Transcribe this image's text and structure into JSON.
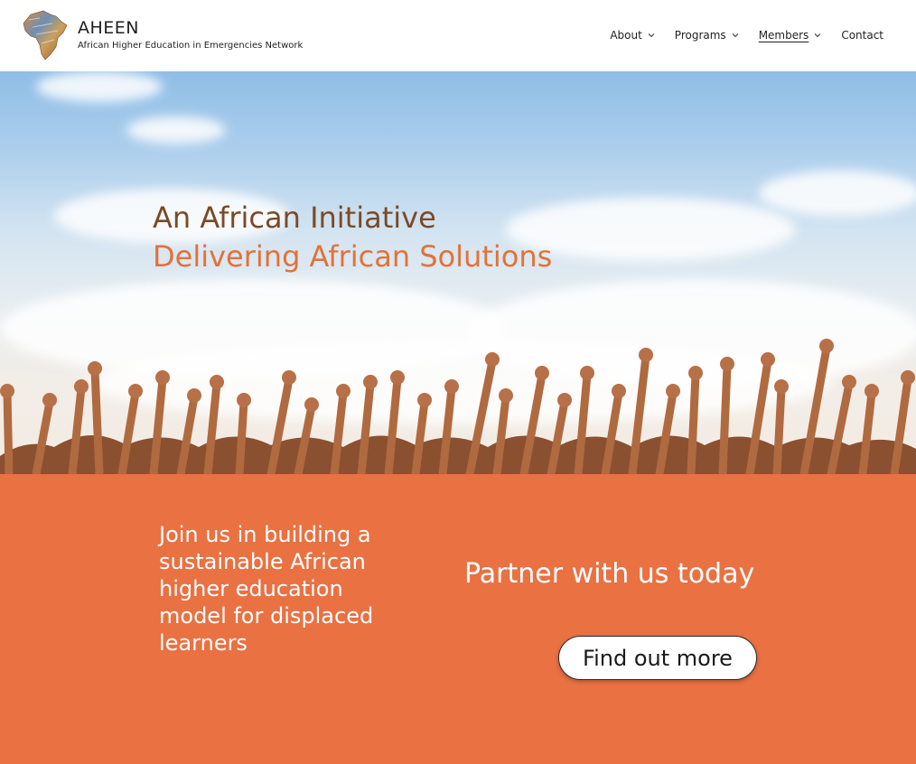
{
  "brand": {
    "title": "AHEEN",
    "subtitle": "African Higher Education in Emergencies Network",
    "logo_icon": "africa-map-logo"
  },
  "nav": {
    "items": [
      {
        "label": "About",
        "has_dropdown": true
      },
      {
        "label": "Programs",
        "has_dropdown": true
      },
      {
        "label": "Members",
        "has_dropdown": true,
        "active": true
      },
      {
        "label": "Contact",
        "has_dropdown": false
      }
    ]
  },
  "hero": {
    "line1": "An African Initiative",
    "line2": "Delivering African Solutions",
    "image": "raised-hands-crowd-icon"
  },
  "cta": {
    "left_text": "Join us in building a sustainable African higher education model for displaced learners",
    "right_title": "Partner with us today",
    "button_label": "Find out more"
  },
  "colors": {
    "accent": "#e97142",
    "heading_brown": "#7a4a26",
    "heading_orange": "#e27238"
  }
}
